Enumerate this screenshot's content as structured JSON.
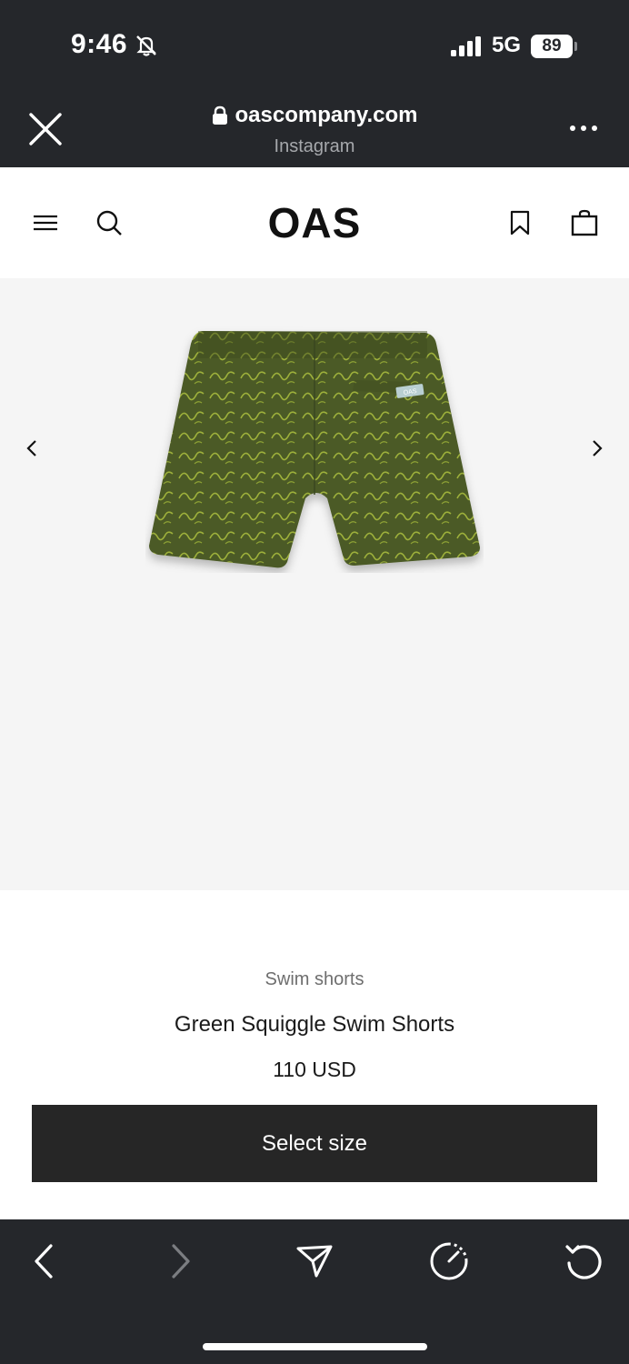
{
  "status_bar": {
    "time": "9:46",
    "network": "5G",
    "battery": "89"
  },
  "browser": {
    "domain": "oascompany.com",
    "source": "Instagram"
  },
  "site": {
    "logo": "OAS"
  },
  "product": {
    "category": "Swim shorts",
    "name": "Green Squiggle Swim Shorts",
    "price": "110 USD",
    "cta": "Select size",
    "tag_text": "OAS"
  },
  "icons": {
    "status": [
      "bell-slash-icon",
      "signal-icon",
      "battery-icon"
    ],
    "browser_top": [
      "close-icon",
      "lock-icon",
      "more-icon"
    ],
    "site_header": [
      "menu-icon",
      "search-icon",
      "bookmark-icon",
      "bag-icon"
    ],
    "gallery": [
      "chevron-left-icon",
      "chevron-right-icon"
    ],
    "toolbar": [
      "back-icon",
      "forward-icon",
      "share-icon",
      "speed-icon",
      "reload-icon"
    ]
  },
  "colors": {
    "chrome": "#25272b",
    "button": "#262626",
    "gallery_bg": "#f5f5f5",
    "shorts": "#4b5a26"
  }
}
